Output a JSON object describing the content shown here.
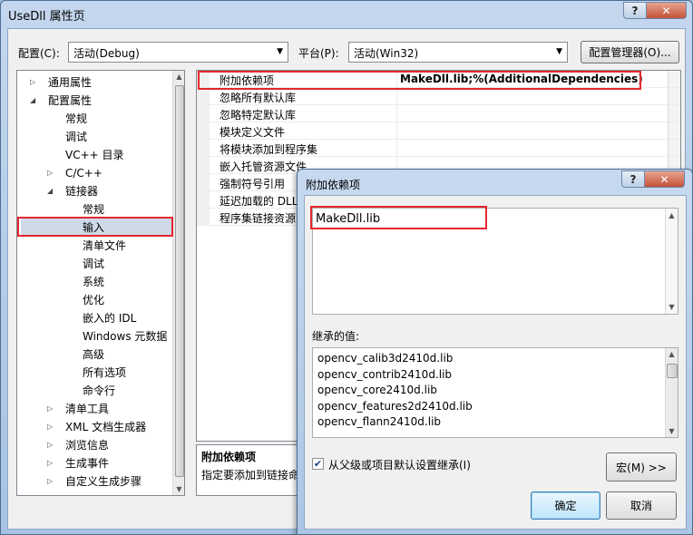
{
  "window": {
    "title": "UseDll 属性页",
    "help_glyph": "?",
    "close_glyph": "✕"
  },
  "toolbar": {
    "config_label": "配置(C):",
    "config_value": "活动(Debug)",
    "platform_label": "平台(P):",
    "platform_value": "活动(Win32)",
    "manager_button": "配置管理器(O)..."
  },
  "tree": {
    "items": [
      {
        "label": "通用属性",
        "expander": "▷"
      },
      {
        "label": "配置属性",
        "expander": "◢"
      },
      {
        "label": "常规",
        "expander": ""
      },
      {
        "label": "调试",
        "expander": ""
      },
      {
        "label": "VC++ 目录",
        "expander": ""
      },
      {
        "label": "C/C++",
        "expander": "▷"
      },
      {
        "label": "链接器",
        "expander": "◢"
      },
      {
        "label": "常规",
        "expander": ""
      },
      {
        "label": "输入",
        "expander": ""
      },
      {
        "label": "清单文件",
        "expander": ""
      },
      {
        "label": "调试",
        "expander": ""
      },
      {
        "label": "系统",
        "expander": ""
      },
      {
        "label": "优化",
        "expander": ""
      },
      {
        "label": "嵌入的 IDL",
        "expander": ""
      },
      {
        "label": "Windows 元数据",
        "expander": ""
      },
      {
        "label": "高级",
        "expander": ""
      },
      {
        "label": "所有选项",
        "expander": ""
      },
      {
        "label": "命令行",
        "expander": ""
      },
      {
        "label": "清单工具",
        "expander": "▷"
      },
      {
        "label": "XML 文档生成器",
        "expander": "▷"
      },
      {
        "label": "浏览信息",
        "expander": "▷"
      },
      {
        "label": "生成事件",
        "expander": "▷"
      },
      {
        "label": "自定义生成步骤",
        "expander": "▷"
      }
    ]
  },
  "grid": {
    "rows": [
      {
        "name": "附加依赖项",
        "value": "MakeDll.lib;%(AdditionalDependencies)"
      },
      {
        "name": "忽略所有默认库",
        "value": ""
      },
      {
        "name": "忽略特定默认库",
        "value": ""
      },
      {
        "name": "模块定义文件",
        "value": ""
      },
      {
        "name": "将模块添加到程序集",
        "value": ""
      },
      {
        "name": "嵌入托管资源文件",
        "value": ""
      },
      {
        "name": "强制符号引用",
        "value": ""
      },
      {
        "name": "延迟加载的 DLL",
        "value": ""
      },
      {
        "name": "程序集链接资源",
        "value": ""
      }
    ]
  },
  "description": {
    "title": "附加依赖项",
    "text": "指定要添加到链接命"
  },
  "dialog": {
    "title": "附加依赖项",
    "help_glyph": "?",
    "close_glyph": "✕",
    "edit_value": "MakeDll.lib",
    "inherited_label": "继承的值:",
    "inherited_values": [
      "opencv_calib3d2410d.lib",
      "opencv_contrib2410d.lib",
      "opencv_core2410d.lib",
      "opencv_features2d2410d.lib",
      "opencv_flann2410d.lib"
    ],
    "checkbox_glyph": "✔",
    "checkbox_label": "从父级或项目默认设置继承(I)",
    "checkbox_checked": true,
    "macro_button": "宏(M) >>",
    "ok_button": "确定",
    "cancel_button": "取消"
  }
}
